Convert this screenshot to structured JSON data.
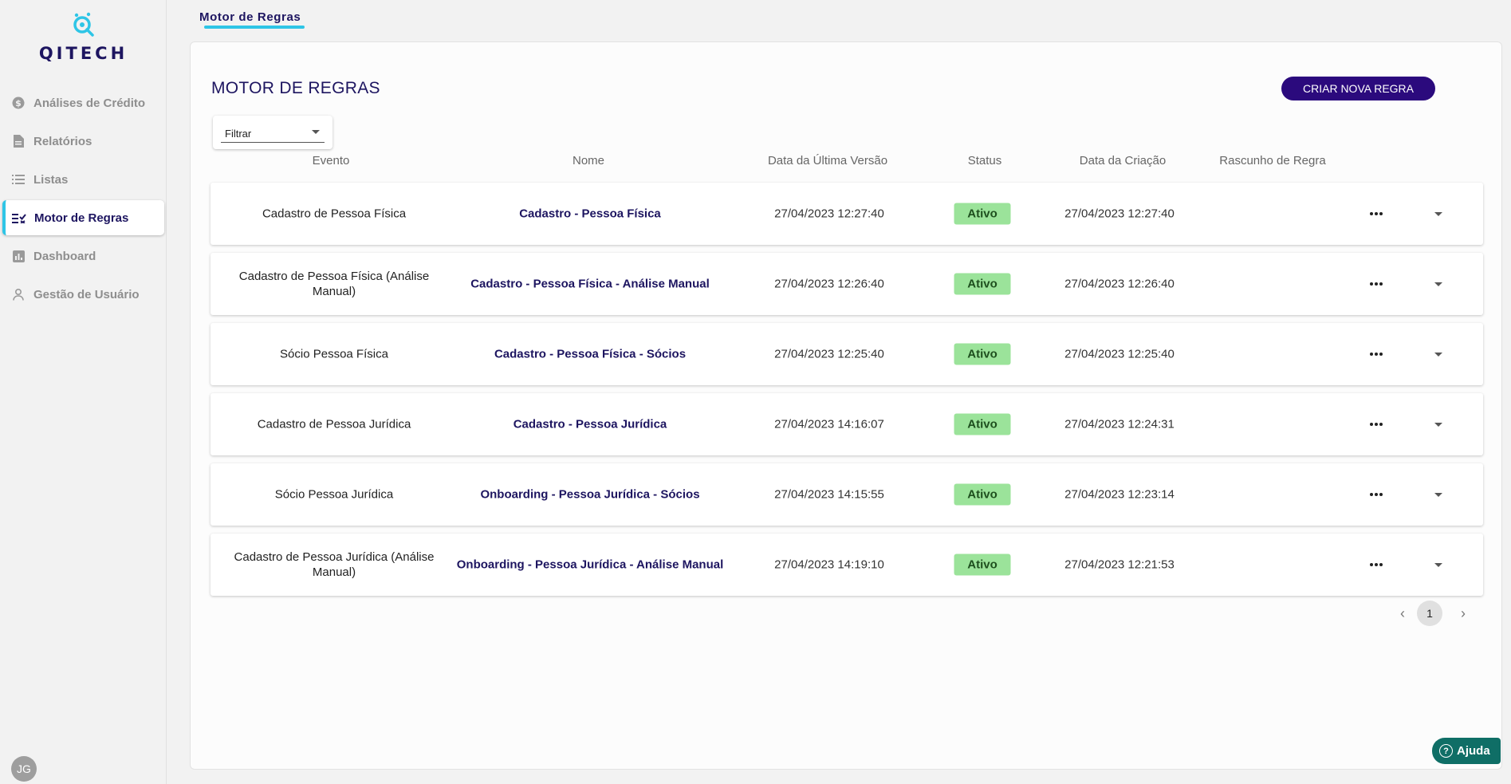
{
  "brand": {
    "name": "QITECH",
    "accent": "#2ec5e6",
    "primary": "#1d1560",
    "button": "#2b0a7d"
  },
  "sidebar": {
    "items": [
      {
        "label": "Análises de Crédito",
        "icon": "dollar-circle-icon",
        "active": false
      },
      {
        "label": "Relatórios",
        "icon": "document-icon",
        "active": false
      },
      {
        "label": "Listas",
        "icon": "list-icon",
        "active": false
      },
      {
        "label": "Motor de Regras",
        "icon": "rules-checklist-icon",
        "active": true
      },
      {
        "label": "Dashboard",
        "icon": "bar-chart-icon",
        "active": false
      },
      {
        "label": "Gestão de Usuário",
        "icon": "user-icon",
        "active": false
      }
    ],
    "avatar_initials": "JG"
  },
  "top_tab": {
    "label": "Motor de Regras"
  },
  "page": {
    "title": "MOTOR DE REGRAS",
    "create_button": "CRIAR NOVA REGRA",
    "filter_label": "Filtrar"
  },
  "table": {
    "headers": [
      "Evento",
      "Nome",
      "Data da Última Versão",
      "Status",
      "Data da Criação",
      "Rascunho de Regra"
    ],
    "rows": [
      {
        "evento": "Cadastro de Pessoa Física",
        "nome": "Cadastro - Pessoa Física",
        "ultima_versao": "27/04/2023 12:27:40",
        "status": "Ativo",
        "criacao": "27/04/2023 12:27:40"
      },
      {
        "evento": "Cadastro de Pessoa Física (Análise Manual)",
        "nome": "Cadastro - Pessoa Física - Análise Manual",
        "ultima_versao": "27/04/2023 12:26:40",
        "status": "Ativo",
        "criacao": "27/04/2023 12:26:40"
      },
      {
        "evento": "Sócio Pessoa Física",
        "nome": "Cadastro - Pessoa Física - Sócios",
        "ultima_versao": "27/04/2023 12:25:40",
        "status": "Ativo",
        "criacao": "27/04/2023 12:25:40"
      },
      {
        "evento": "Cadastro de Pessoa Jurídica",
        "nome": "Cadastro - Pessoa Jurídica",
        "ultima_versao": "27/04/2023 14:16:07",
        "status": "Ativo",
        "criacao": "27/04/2023 12:24:31"
      },
      {
        "evento": "Sócio Pessoa Jurídica",
        "nome": "Onboarding - Pessoa Jurídica - Sócios",
        "ultima_versao": "27/04/2023 14:15:55",
        "status": "Ativo",
        "criacao": "27/04/2023 12:23:14"
      },
      {
        "evento": "Cadastro de Pessoa Jurídica (Análise Manual)",
        "nome": "Onboarding - Pessoa Jurídica - Análise Manual",
        "ultima_versao": "27/04/2023 14:19:10",
        "status": "Ativo",
        "criacao": "27/04/2023 12:21:53"
      }
    ],
    "status_color": "#9be39a"
  },
  "pagination": {
    "current": "1"
  },
  "help": {
    "label": "Ajuda"
  }
}
